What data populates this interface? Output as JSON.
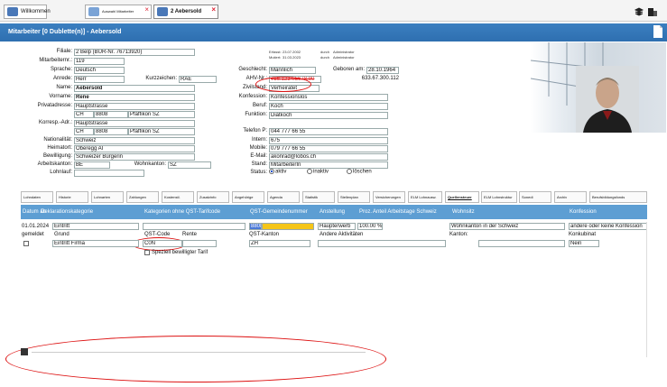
{
  "window_tabs": [
    {
      "label": "Willkommen"
    },
    {
      "label": "Auswahl Mitarbeiter"
    },
    {
      "label": "2 Aebersold"
    }
  ],
  "header": {
    "title": "Mitarbeiter [0 Dublette(n)] - Aebersold"
  },
  "form": {
    "filiale_label": "Filiale:",
    "filiale": "2 Belp (BUR-Nr. 76713920)",
    "mitarbeiternr_label": "Mitarbeiternr.:",
    "mitarbeiternr": "119",
    "sprache_label": "Sprache:",
    "sprache": "Deutsch",
    "anrede_label": "Anrede:",
    "anrede": "Herr",
    "kurzzeichen_label": "Kurzzeichen:",
    "kurzzeichen": "RAE",
    "name_label": "Name:",
    "name": "Aebersold",
    "vorname_label": "Vorname:",
    "vorname": "Rene",
    "privatadresse_label": "Privatadresse:",
    "privat_strasse": "Hauptstrasse",
    "privat_land": "CH",
    "privat_plz": "8808",
    "privat_ort": "Pfäffikon SZ",
    "korresp_label": "Korresp.-Adr.:",
    "korresp_strasse": "Hauptstrasse",
    "korresp_land": "CH",
    "korresp_plz": "8808",
    "korresp_ort": "Pfäffikon SZ",
    "nationalitaet_label": "Nationalität:",
    "nationalitaet": "Schweiz",
    "heimatort_label": "Heimatort:",
    "heimatort": "Oberegg AI",
    "bewilligung_label": "Bewilligung:",
    "bewilligung": "Schweizer Bürgerin",
    "arbeitskanton_label": "Arbeitskanton:",
    "arbeitskanton": "BE",
    "wohnkanton_label": "Wohnkanton:",
    "wohnkanton": "SZ",
    "lohnlauf_label": "Lohnlauf:",
    "lohnlauf": "",
    "erfasst_label": "Erfasst:",
    "erfasst_date": "23.07.2002",
    "erfasst_durch": "durch",
    "erfasst_user": "Administrator",
    "mutiert_label": "Mutiert:",
    "mutiert_date": "31.03.2023",
    "mutiert_durch": "durch",
    "mutiert_user": "Administrator",
    "geschlecht_label": "Geschlecht:",
    "geschlecht": "Männlich",
    "geboren_label": "Geboren am:",
    "geboren": "28.10.1964",
    "ahv_label": "AHV-Nr.:",
    "ahv": "756.1234.5678.90",
    "ahv_alt": "633.67.300.112",
    "zivilstand_label": "Zivilstand:",
    "zivilstand": "Verheiratet",
    "konfession_label": "Konfession:",
    "konfession": "Konfessionslos",
    "beruf_label": "Beruf:",
    "beruf": "Koch",
    "funktion_label": "Funktion:",
    "funktion": "Diätkoch",
    "telefon_label": "Telefon P:",
    "telefon": "044 777 66 55",
    "intern_label": "Intern:",
    "intern": "675",
    "mobile_label": "Mobile:",
    "mobile": "079 777 66 55",
    "email_label": "E-Mail:",
    "email": "akonrad@lobos.ch",
    "stand_label": "Stand:",
    "stand": "MitarbeiterIn",
    "status_label": "Status:",
    "status_aktiv": "aktiv",
    "status_inaktiv": "inaktiv",
    "status_loeschen": "löschen"
  },
  "subtabs": [
    "Lohndaten",
    "Historie",
    "Lohnarten",
    "Zahlungen",
    "Kostenstl.",
    "Zusatzinfo",
    "Angehörige",
    "Agenda",
    "Statistik",
    "Stellenplan",
    "Versicherungen",
    "ELM Lohnausw.",
    "Quellensteuer",
    "ELM Lohnstruktur",
    "Sonedi",
    "Archiv",
    "Berufsbildungsfonds"
  ],
  "table": {
    "headers": [
      "Datum ab",
      "Deklarationskategorie",
      "Kategorien ohne QST-Tarifcode",
      "QST-Gemeindenummer",
      "Anstellung",
      "Proz.",
      "Anteil Arbeitstage Schweiz",
      "Wohnsitz",
      "Konfession"
    ],
    "row1": {
      "datum": "01.01.2024",
      "kategorie": "Eintritt",
      "gemeindenr": "8808",
      "anstellung": "Haupterwerb",
      "proz": "100.00 %",
      "wohnsitz": "Wohnkanton in der Schweiz",
      "konfession": "andere oder keine Konfession"
    },
    "row2": {
      "gemeldet": "gemeldet",
      "grund_label": "Grund",
      "qst_code_label": "QST-Code",
      "rente_label": "Rente",
      "qst_kanton_label": "QST-Kanton",
      "aktivitaeten_label": "Andere Aktivitäten",
      "kanton_label": "Kanton:",
      "konkubinat_label": "Konkubinat"
    },
    "row3": {
      "grund": "Eintritt Firma",
      "qst_code": "C0N",
      "qst_kanton": "ZH",
      "konkubinat": "Nein"
    },
    "speziell_label": "Speziell bewilligter Tarif"
  }
}
